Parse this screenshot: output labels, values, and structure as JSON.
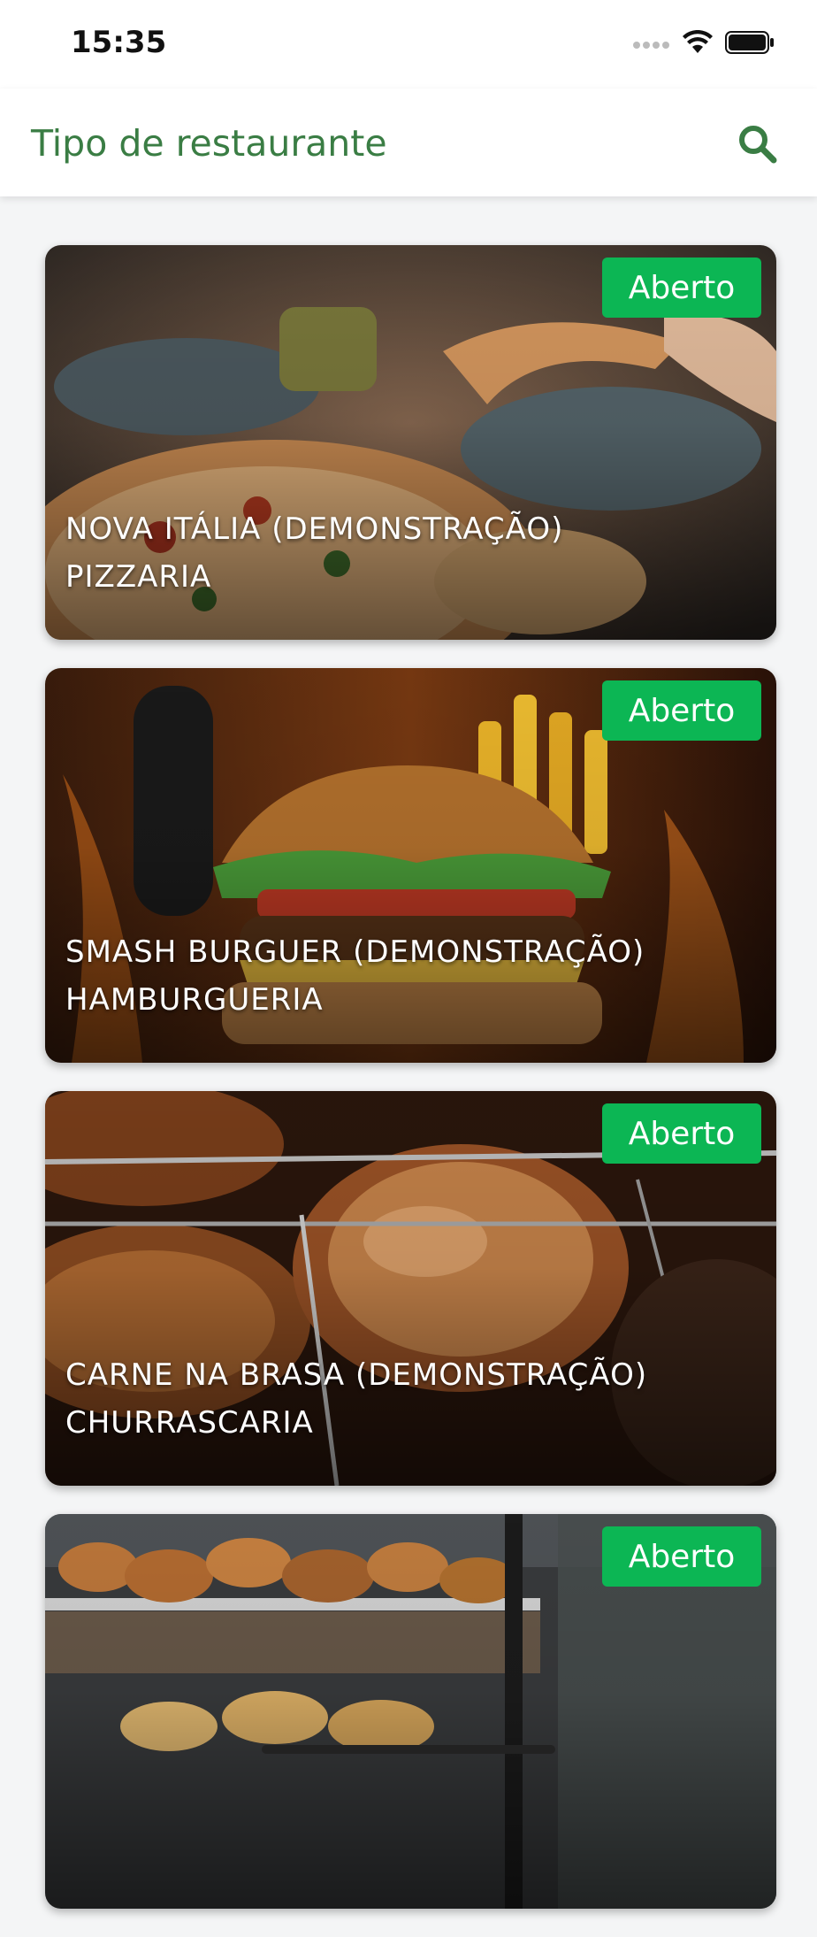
{
  "status": {
    "time": "15:35",
    "icons": [
      "signal-dots-icon",
      "wifi-icon",
      "battery-icon"
    ]
  },
  "header": {
    "title": "Tipo de restaurante",
    "search_icon": "search-icon"
  },
  "colors": {
    "accent": "#3a7d44",
    "badge_open": "#0cb654"
  },
  "restaurants": [
    {
      "name": "NOVA ITÁLIA (DEMONSTRAÇÃO)",
      "category": "PIZZARIA",
      "status": "Aberto",
      "image": "pizza-photo"
    },
    {
      "name": "SMASH BURGUER (DEMONSTRAÇÃO)",
      "category": "HAMBURGUERIA",
      "status": "Aberto",
      "image": "burger-photo"
    },
    {
      "name": "CARNE NA BRASA (DEMONSTRAÇÃO)",
      "category": "CHURRASCARIA",
      "status": "Aberto",
      "image": "grilled-meat-photo"
    },
    {
      "name": "",
      "category": "",
      "status": "Aberto",
      "image": "bakery-photo"
    }
  ]
}
